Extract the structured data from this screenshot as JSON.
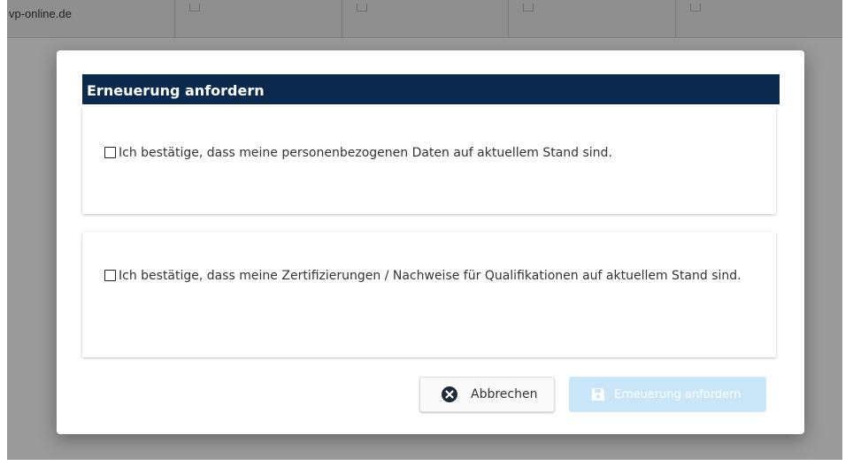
{
  "background": {
    "url_cell": "vp-online.de"
  },
  "modal": {
    "title": "Erneuerung anfordern",
    "checks": [
      {
        "label": "Ich bestätige, dass meine personenbezogenen Daten auf aktuellem Stand sind.",
        "checked": false
      },
      {
        "label": "Ich bestätige, dass meine Zertifizierungen / Nachweise für Qualifikationen auf aktuellem Stand sind.",
        "checked": false
      }
    ],
    "buttons": {
      "cancel_label": "Abbrechen",
      "cancel_icon": "close-circle-icon",
      "submit_label": "Erneuerung anfordern",
      "submit_icon": "save-icon",
      "submit_disabled": true
    }
  },
  "colors": {
    "header_bg": "#0b2a4d",
    "submit_bg_disabled": "#c9e6f8",
    "overlay": "#9a9a9a"
  }
}
